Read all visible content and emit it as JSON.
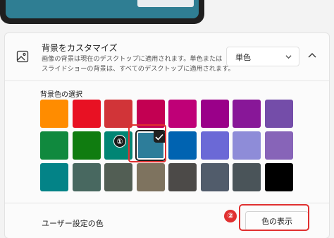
{
  "background": {
    "title": "背景をカスタマイズ",
    "description_line1": "画像の背景は現在のデスクトップに適用されます。単色または",
    "description_line2": "スライドショーの背景は、すべてのデスクトップに適用されます。",
    "select_value": "単色",
    "icon": "image-icon",
    "collapse_icon": "chevron-up-icon"
  },
  "color_picker": {
    "label": "背景色の選択",
    "selected_index": 11,
    "colors": [
      "#ff8c00",
      "#e81123",
      "#d13438",
      "#c30052",
      "#bf0077",
      "#9a0089",
      "#881798",
      "#744da9",
      "#10893e",
      "#107c10",
      "#018574",
      "#2d7d9a",
      "#0063b1",
      "#6b69d6",
      "#8e8cd8",
      "#8764b8",
      "#038387",
      "#486860",
      "#525e54",
      "#7e735f",
      "#4c4a48",
      "#515c6b",
      "#4a5459",
      "#000000"
    ]
  },
  "custom_color": {
    "label": "ユーザー設定の色",
    "button_label": "色の表示"
  },
  "annotations": {
    "step1": "①",
    "step2": "②",
    "highlight_color": "#e03030"
  }
}
